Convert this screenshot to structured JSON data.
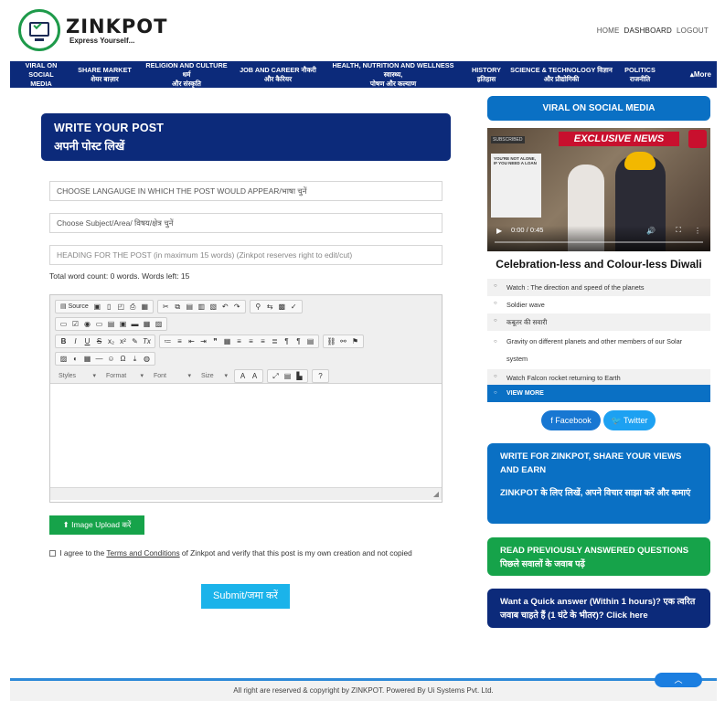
{
  "brand": {
    "name": "ZINKPOT",
    "tagline": "Express Yourself..."
  },
  "top_links": [
    "HOME",
    "DASHBOARD",
    "LOGOUT"
  ],
  "nav": {
    "items": [
      {
        "line1": "VIRAL ON SOCIAL",
        "line2": "MEDIA"
      },
      {
        "line1": "SHARE MARKET",
        "line2": "शेयर बाज़ार"
      },
      {
        "line1": "RELIGION AND CULTURE धर्म",
        "line2": "और संस्कृति"
      },
      {
        "line1": "JOB AND CAREER नौकरी",
        "line2": "और कैरियर"
      },
      {
        "line1": "HEALTH, NUTRITION AND WELLNESS स्वास्थ्य,",
        "line2": "पोषण और कल्याण"
      },
      {
        "line1": "HISTORY",
        "line2": "इतिहास"
      },
      {
        "line1": "SCIENCE & TECHNOLOGY विज्ञान",
        "line2": "और प्रौद्योगिकी"
      },
      {
        "line1": "POLITICS",
        "line2": "राजनीति"
      }
    ],
    "more": "▴More"
  },
  "write_post": {
    "title_en": "WRITE YOUR POST",
    "title_hi": "अपनी पोस्ट लिखें"
  },
  "fields": {
    "language": "CHOOSE LANGAUGE IN WHICH THE POST WOULD APPEAR/भाषा चुनें",
    "subject": "Choose Subject/Area/ विषय/क्षेत्र चुनें",
    "heading_placeholder": "HEADING FOR THE POST (in maximum 15 words) (Zinkpot reserves right to edit/cut)"
  },
  "word_count": "Total word count: 0 words. Words left: 15",
  "editor": {
    "source_label": "Source",
    "styles": "Styles",
    "format": "Format",
    "font": "Font",
    "size": "Size"
  },
  "upload_label": "Image Upload करें",
  "agree": {
    "before": "I agree to the ",
    "link": "Terms and Conditions",
    "after": " of Zinkpot and verify that this post is my own creation and not copied"
  },
  "submit_label": "Submit/जमा करें",
  "sidebar": {
    "viral_title": "VIRAL ON SOCIAL MEDIA",
    "video": {
      "banner": "EXCLUSIVE NEWS",
      "subscribed": "SUBSCRIBED",
      "ad_text": "YOU'RE NOT ALONE, IF YOU NEED A LOAN",
      "time": "0:00 / 0:45",
      "progress": 0
    },
    "video_title": "Celebration-less and Colour-less Diwali",
    "list": [
      "Watch : The direction and speed of the planets",
      "Soldier wave",
      "कबूतर की सवारी",
      "Gravity on different planets and other members of our Solar system",
      "Watch Falcon rocket returning to Earth"
    ],
    "view_more": "VIEW MORE",
    "facebook": "Facebook",
    "twitter": "Twitter",
    "write_box": {
      "en": "WRITE FOR ZINKPOT, SHARE YOUR VIEWS AND EARN",
      "hi": "ZINKPOT के लिए लिखें, अपने विचार साझा करें और कमाएं"
    },
    "read_box": {
      "en": "READ PREVIOUSLY ANSWERED QUESTIONS",
      "hi": "पिछले सवालों के जवाब पढ़ें"
    },
    "quick_box": "Want a Quick answer (Within 1 hours)? एक त्वरित जवाब चाहते हैं (1 घंटे के भीतर)? Click here"
  },
  "footer": "All right are reserved & copyright by ZINKPOT. Powered By Ui Systems Pvt. Ltd."
}
